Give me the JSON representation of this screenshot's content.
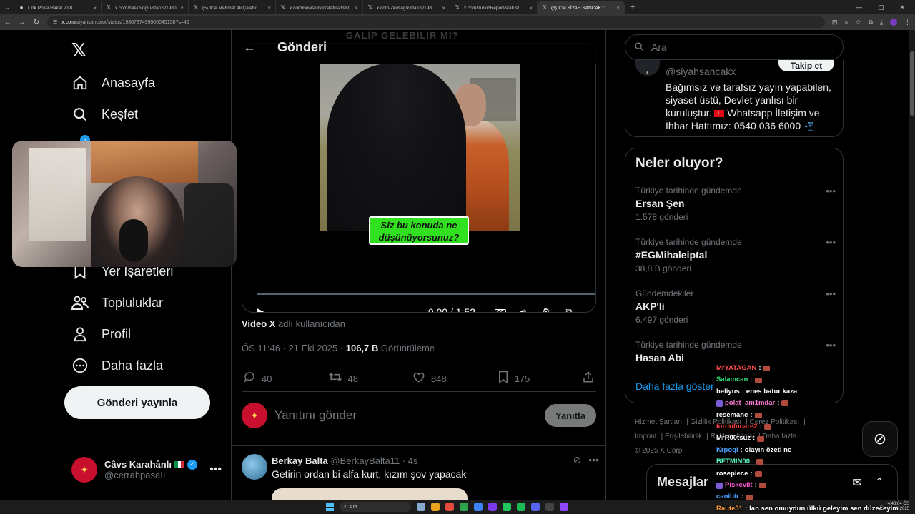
{
  "browser": {
    "tabs": [
      {
        "title": "Link Polisi Hakat v0.8",
        "icon": "link-icon",
        "active": false
      },
      {
        "title": "x.com/haskologlu/status/1980",
        "icon": "x-icon",
        "active": false
      },
      {
        "title": "(5) X'te Mehmet Ali Çelebi: \"Ça",
        "icon": "x-icon",
        "active": false
      },
      {
        "title": "x.com/newsturkic/status/1980",
        "icon": "x-icon",
        "active": false
      },
      {
        "title": "x.com/Zkusagiz/status/198073",
        "icon": "x-icon",
        "active": false
      },
      {
        "title": "x.com/TurkicReport/status/198",
        "icon": "x-icon",
        "active": false
      },
      {
        "title": "(3) X'te SİYAH SANCAK: \"🔵 Bi",
        "icon": "x-icon",
        "active": true
      }
    ],
    "url_domain": "x.com",
    "url_path": "/siyahsancakx/status/1980737499506045158?s=46"
  },
  "nav": {
    "home": "Anasayfa",
    "explore": "Keşfet",
    "bookmarks": "Yer İşaretleri",
    "communities": "Topluluklar",
    "profile": "Profil",
    "more": "Daha fazla",
    "post_button": "Gönderi yayınla",
    "notif_count": "3",
    "account": {
      "name": "Câvs Karahânlı",
      "handle": "@cerrahpasaIı"
    }
  },
  "post": {
    "header_title": "Gönderi",
    "header_ghost": "GALİP GELEBİLİR Mİ?",
    "caption_line1": "Siz bu konuda ne",
    "caption_line2": "düşünüyorsunuz?",
    "video_time": "0:00 / 1:52",
    "video_by_bold": "Video X",
    "video_by_rest": " adlı kullanıcıdan",
    "timestamp": "ÖS 11:46 · 21 Eki 2025 · ",
    "views_bold": "106,7 B",
    "views_label": " Görüntüleme",
    "replies": "40",
    "reposts": "48",
    "likes": "848",
    "bookmarks": "175",
    "reply_placeholder": "Yanıtını gönder",
    "reply_button": "Yanıtla"
  },
  "reply_tweet": {
    "name": "Berkay Balta",
    "handle_time": " @BerkayBalta11 · 4s",
    "text": "Getirin ordan bi alfa kurt, kızım şov yapacak"
  },
  "right": {
    "search_placeholder": "Ara",
    "profile_card": {
      "handle": "@siyahsancakx",
      "follow": "Takip et",
      "bio_1": "Bağımsız ve tarafsız yayın yapabilen, siyaset üstü, Devlet yanlısı bir kuruluştur. ",
      "bio_2": " Whatsapp İletişim ve İhbar Hattımız: 0540 036 6000 "
    },
    "trends_title": "Neler oluyor?",
    "trends": [
      {
        "context": "Türkiye tarihinde gündemde",
        "name": "Ersan Şen",
        "count": "1.578 gönderi"
      },
      {
        "context": "Türkiye tarihinde gündemde",
        "name": "#EGMihaleiptal",
        "count": "38,8 B gönderi"
      },
      {
        "context": "Gündemdekiler",
        "name": "AKP'li",
        "count": "6.497 gönderi"
      },
      {
        "context": "Türkiye tarihinde gündemde",
        "name": "Hasan Abi",
        "count": ""
      }
    ],
    "show_more": "Daha fazla göster",
    "footer": {
      "terms": "Hizmet Şartları",
      "privacy": "Gizlilik Politikası",
      "cookie": "Çerez Politikası",
      "imprint": "Imprint",
      "access": "Erişilebilirlik",
      "ads": "Reklam bilgisi",
      "more": "Daha fazla ...",
      "copyright": "© 2025 X Corp."
    },
    "messages_title": "Mesajlar"
  },
  "chat": [
    {
      "user": "MrYATAGAN",
      "color": "#ff4d4d",
      "text": "",
      "emote": true
    },
    {
      "user": "Salamcan",
      "color": "#2ee37a",
      "text": "",
      "emote": true
    },
    {
      "user": "heliyus",
      "color": "#ffffff",
      "text": "enes batur kaza",
      "emote": false
    },
    {
      "user": "polat_am1mdar",
      "color": "#ff7ad9",
      "text": "",
      "emote": true,
      "badge": true
    },
    {
      "user": "resemahe",
      "color": "#ffffff",
      "text": "",
      "emote": true
    },
    {
      "user": "lordofncare2",
      "color": "#ff3b3b",
      "text": "",
      "emote": true
    },
    {
      "user": "MrR00tsuz",
      "color": "#ffffff",
      "text": "",
      "emote": true
    },
    {
      "user": "Krpogl",
      "color": "#4aa3ff",
      "text": "olayın özeti ne",
      "emote": false
    },
    {
      "user": "BETMIN00",
      "color": "#5effc8",
      "text": "",
      "emote": true
    },
    {
      "user": "rosepiece",
      "color": "#ffffff",
      "text": "",
      "emote": true
    },
    {
      "user": "Piskevilt",
      "color": "#ff5ad0",
      "text": "",
      "emote": true,
      "badge": true
    },
    {
      "user": "canibtr",
      "color": "#4aa3ff",
      "text": "",
      "emote": true
    },
    {
      "user": "Raute31",
      "color": "#ff9a3c",
      "text": "lan sen omuydun ülkü geleyim sen düzeceyim",
      "emote": false
    }
  ],
  "taskbar": {
    "search": "Ara",
    "time": "4:48:04 ÖS",
    "date": "21.10.2025"
  },
  "colors": {
    "accent": "#1d9bf0",
    "caption_bg": "#31e01e",
    "background": "#000000"
  }
}
